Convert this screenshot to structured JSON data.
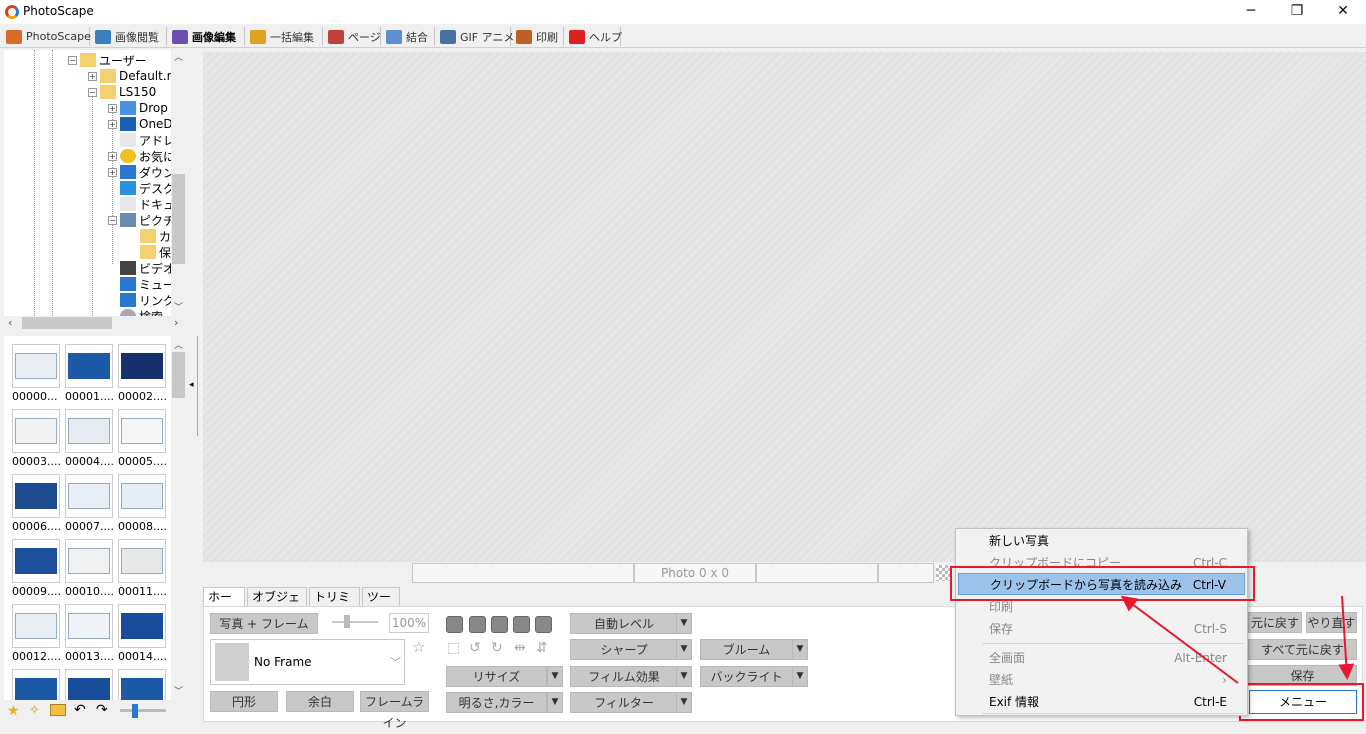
{
  "window": {
    "title": "PhotoScape",
    "minimize": "─",
    "maximize": "❐",
    "close": "✕"
  },
  "tabs": [
    {
      "label": "PhotoScape",
      "color": "#d86a2a"
    },
    {
      "label": "画像閲覧",
      "color": "#3a7fc0"
    },
    {
      "label": "画像編集",
      "color": "#6a4fb0",
      "active": true
    },
    {
      "label": "一括編集",
      "color": "#e0a020"
    },
    {
      "label": "ページ",
      "color": "#c04040"
    },
    {
      "label": "結合",
      "color": "#5a8fd0"
    },
    {
      "label": "GIF アニメ",
      "color": "#4a6fa0"
    },
    {
      "label": "印刷",
      "color": "#c06020"
    },
    {
      "label": "ヘルプ",
      "color": "#e02020"
    }
  ],
  "tree": [
    {
      "label": "ユーザー",
      "icon": "folder-icon",
      "expanded": true
    },
    {
      "label": "Default.m",
      "icon": "folder-icon"
    },
    {
      "label": "LS150",
      "icon": "folder-icon",
      "expanded": true
    },
    {
      "label": "Drop",
      "icon": "dropbox-icon"
    },
    {
      "label": "OneD",
      "icon": "onedrive-icon"
    },
    {
      "label": "アドレ",
      "icon": "contacts-icon"
    },
    {
      "label": "お気に",
      "icon": "star-icon"
    },
    {
      "label": "ダウン",
      "icon": "download-icon"
    },
    {
      "label": "デスク",
      "icon": "desktop-icon"
    },
    {
      "label": "ドキュ",
      "icon": "document-icon"
    },
    {
      "label": "ピクチ",
      "icon": "pictures-icon",
      "expanded": true
    },
    {
      "label": "カ",
      "icon": "folder-icon"
    },
    {
      "label": "保",
      "icon": "folder-icon"
    },
    {
      "label": "ビデオ",
      "icon": "video-icon"
    },
    {
      "label": "ミュー",
      "icon": "music-icon"
    },
    {
      "label": "リンク",
      "icon": "link-icon"
    },
    {
      "label": "検索",
      "icon": "search-icon"
    }
  ],
  "thumbnails": [
    "00000...",
    "00001....",
    "00002....",
    "00003....",
    "00004....",
    "00005....",
    "00006....",
    "00007....",
    "00008....",
    "00009....",
    "00010....",
    "00011....",
    "00012....",
    "00013....",
    "00014....",
    "",
    "",
    ""
  ],
  "status": {
    "photo_size": "Photo 0 x 0"
  },
  "edit_tabs": [
    "ホーム",
    "オブジェクト",
    "トリミング",
    "ツール"
  ],
  "edit": {
    "photo_frame": "写真 + フレーム",
    "zoom": "100%",
    "frame_name": "No Frame",
    "circle": "円形",
    "margin": "余白",
    "frame_line": "フレームライン",
    "resize": "リサイズ",
    "brightness_color": "明るさ,カラー",
    "auto_level": "自動レベル",
    "sharpen": "シャープ",
    "film_effect": "フィルム効果",
    "filter": "フィルター",
    "bloom": "ブルーム",
    "backlight": "バックライト",
    "undo": "元に戻す",
    "redo": "やり直す",
    "undo_all": "すべて元に戻す",
    "save": "保存",
    "menu": "メニュー"
  },
  "context_menu": {
    "items": [
      {
        "label": "新しい写真",
        "shortcut": "",
        "disabled": false
      },
      {
        "label": "クリップボードにコピー",
        "shortcut": "Ctrl-C",
        "disabled": true
      },
      {
        "label": "クリップボードから写真を読み込み",
        "shortcut": "Ctrl-V",
        "highlighted": true
      },
      {
        "label": "印刷",
        "shortcut": "",
        "disabled": true
      },
      {
        "label": "保存",
        "shortcut": "Ctrl-S",
        "disabled": true
      },
      {
        "label": "全画面",
        "shortcut": "Alt-Enter",
        "disabled": true
      },
      {
        "label": "壁紙",
        "shortcut": "›",
        "disabled": true
      },
      {
        "label": "Exif 情報",
        "shortcut": "Ctrl-E",
        "disabled": false
      }
    ]
  },
  "colors": {
    "highlight_red": "#e8192c",
    "menu_highlight": "#9cc3ea"
  }
}
